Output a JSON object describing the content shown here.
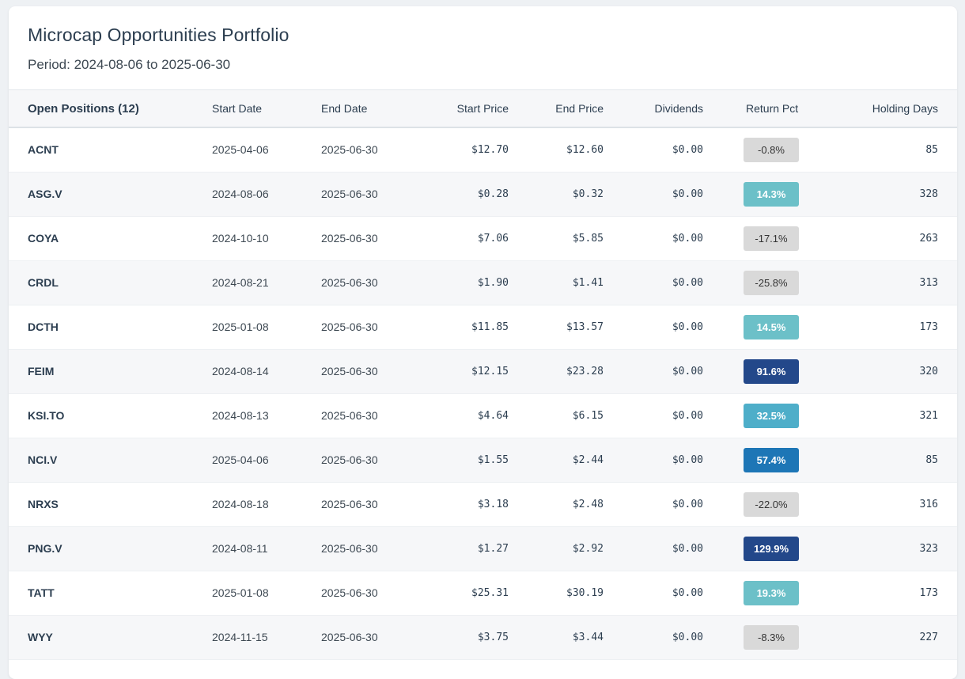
{
  "title": "Microcap Opportunities Portfolio",
  "period": "Period: 2024-08-06 to 2025-06-30",
  "columns": {
    "positions": "Open Positions (12)",
    "start_date": "Start Date",
    "end_date": "End Date",
    "start_price": "Start Price",
    "end_price": "End Price",
    "dividends": "Dividends",
    "return_pct": "Return Pct",
    "holding_days": "Holding Days"
  },
  "rows": [
    {
      "ticker": "ACNT",
      "start_date": "2025-04-06",
      "end_date": "2025-06-30",
      "start_price": "$12.70",
      "end_price": "$12.60",
      "dividends": "$0.00",
      "return_pct": "-0.8%",
      "return_value": -0.8,
      "holding_days": "85"
    },
    {
      "ticker": "ASG.V",
      "start_date": "2024-08-06",
      "end_date": "2025-06-30",
      "start_price": "$0.28",
      "end_price": "$0.32",
      "dividends": "$0.00",
      "return_pct": "14.3%",
      "return_value": 14.3,
      "holding_days": "328"
    },
    {
      "ticker": "COYA",
      "start_date": "2024-10-10",
      "end_date": "2025-06-30",
      "start_price": "$7.06",
      "end_price": "$5.85",
      "dividends": "$0.00",
      "return_pct": "-17.1%",
      "return_value": -17.1,
      "holding_days": "263"
    },
    {
      "ticker": "CRDL",
      "start_date": "2024-08-21",
      "end_date": "2025-06-30",
      "start_price": "$1.90",
      "end_price": "$1.41",
      "dividends": "$0.00",
      "return_pct": "-25.8%",
      "return_value": -25.8,
      "holding_days": "313"
    },
    {
      "ticker": "DCTH",
      "start_date": "2025-01-08",
      "end_date": "2025-06-30",
      "start_price": "$11.85",
      "end_price": "$13.57",
      "dividends": "$0.00",
      "return_pct": "14.5%",
      "return_value": 14.5,
      "holding_days": "173"
    },
    {
      "ticker": "FEIM",
      "start_date": "2024-08-14",
      "end_date": "2025-06-30",
      "start_price": "$12.15",
      "end_price": "$23.28",
      "dividends": "$0.00",
      "return_pct": "91.6%",
      "return_value": 91.6,
      "holding_days": "320"
    },
    {
      "ticker": "KSI.TO",
      "start_date": "2024-08-13",
      "end_date": "2025-06-30",
      "start_price": "$4.64",
      "end_price": "$6.15",
      "dividends": "$0.00",
      "return_pct": "32.5%",
      "return_value": 32.5,
      "holding_days": "321"
    },
    {
      "ticker": "NCI.V",
      "start_date": "2025-04-06",
      "end_date": "2025-06-30",
      "start_price": "$1.55",
      "end_price": "$2.44",
      "dividends": "$0.00",
      "return_pct": "57.4%",
      "return_value": 57.4,
      "holding_days": "85"
    },
    {
      "ticker": "NRXS",
      "start_date": "2024-08-18",
      "end_date": "2025-06-30",
      "start_price": "$3.18",
      "end_price": "$2.48",
      "dividends": "$0.00",
      "return_pct": "-22.0%",
      "return_value": -22.0,
      "holding_days": "316"
    },
    {
      "ticker": "PNG.V",
      "start_date": "2024-08-11",
      "end_date": "2025-06-30",
      "start_price": "$1.27",
      "end_price": "$2.92",
      "dividends": "$0.00",
      "return_pct": "129.9%",
      "return_value": 129.9,
      "holding_days": "323"
    },
    {
      "ticker": "TATT",
      "start_date": "2025-01-08",
      "end_date": "2025-06-30",
      "start_price": "$25.31",
      "end_price": "$30.19",
      "dividends": "$0.00",
      "return_pct": "19.3%",
      "return_value": 19.3,
      "holding_days": "173"
    },
    {
      "ticker": "WYY",
      "start_date": "2024-11-15",
      "end_date": "2025-06-30",
      "start_price": "$3.75",
      "end_price": "$3.44",
      "dividends": "$0.00",
      "return_pct": "-8.3%",
      "return_value": -8.3,
      "holding_days": "227"
    }
  ]
}
